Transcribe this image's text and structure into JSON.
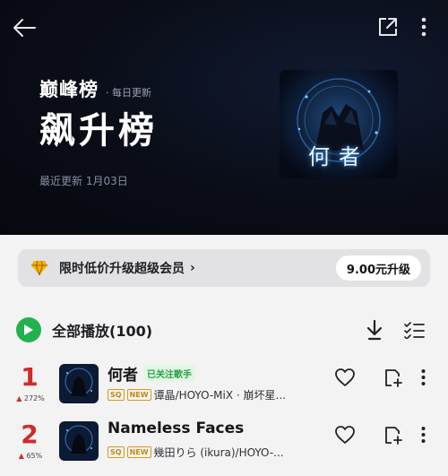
{
  "header": {
    "brand_title": "巅峰榜",
    "brand_sub": "· 每日更新",
    "chart_title": "飙升榜",
    "update_text": "最近更新 1月03日",
    "cover_caption": "何者"
  },
  "vip_banner": {
    "text": "限时低价升级超级会员",
    "chevron": "›",
    "button_label": "9.00元升级"
  },
  "toolbar": {
    "play_all_label": "全部播放(100)"
  },
  "songs": [
    {
      "rank": "1",
      "trend": "272%",
      "title": "何者",
      "follow_tag": "已关注歌手",
      "badge_sq": "SQ",
      "badge_new": "NEW",
      "artist": "谭晶/HOYO-MiX · 崩坏星..."
    },
    {
      "rank": "2",
      "trend": "65%",
      "title": "Nameless Faces",
      "follow_tag": "",
      "badge_sq": "SQ",
      "badge_new": "NEW",
      "artist": "幾田りら (ikura)/HOYO-..."
    }
  ],
  "colors": {
    "accent_green": "#22b14c",
    "rank_red": "#cf2b2b",
    "badge_gold": "#d49a1a",
    "header_bg": "#0a0d17"
  },
  "icons": [
    "back-arrow-icon",
    "share-icon",
    "more-vertical-icon",
    "diamond-icon",
    "play-icon",
    "download-icon",
    "multi-select-icon",
    "heart-icon",
    "add-to-playlist-icon"
  ]
}
